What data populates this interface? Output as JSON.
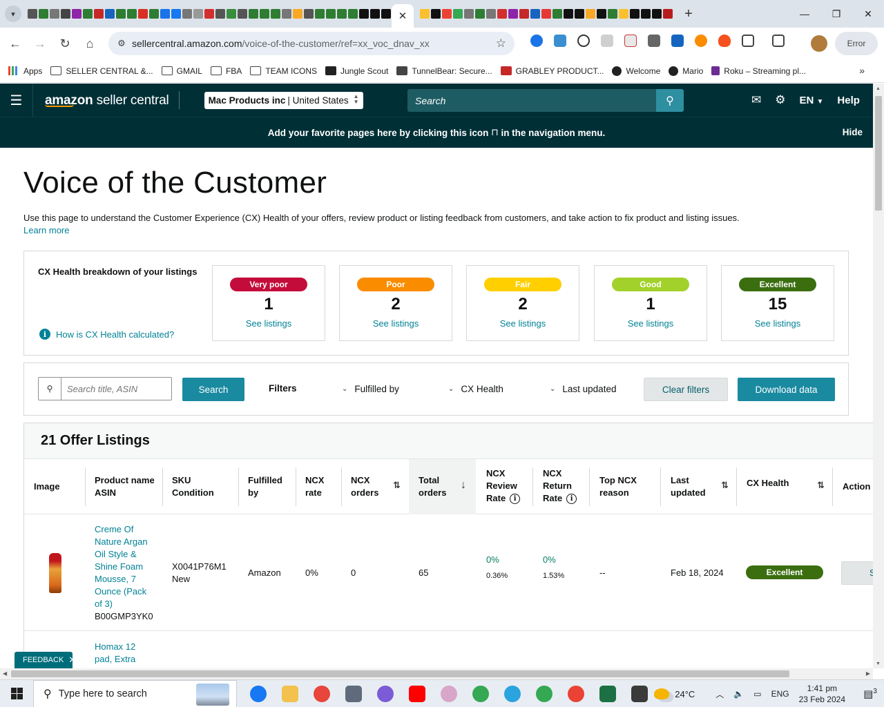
{
  "browser": {
    "url_host": "sellercentral.amazon.com",
    "url_path": "/voice-of-the-customer/ref=xx_voc_dnav_xx",
    "error_label": "Error",
    "bookmarks": [
      {
        "label": "Apps",
        "icon": "apps-grid-icon"
      },
      {
        "label": "SELLER CENTRAL &...",
        "icon": "folder-icon"
      },
      {
        "label": "GMAIL",
        "icon": "folder-icon"
      },
      {
        "label": "FBA",
        "icon": "folder-icon"
      },
      {
        "label": "TEAM ICONS",
        "icon": "folder-icon"
      },
      {
        "label": "Jungle Scout",
        "icon": "junglescout-icon"
      },
      {
        "label": "TunnelBear: Secure...",
        "icon": "tunnelbear-icon"
      },
      {
        "label": "GRABLEY PRODUCT...",
        "icon": "grabley-icon"
      },
      {
        "label": "Welcome",
        "icon": "globe-icon"
      },
      {
        "label": "Mario",
        "icon": "globe-icon"
      },
      {
        "label": "Roku – Streaming pl...",
        "icon": "roku-icon"
      }
    ]
  },
  "header": {
    "logo_text": "amazon",
    "logo_suffix": "seller central",
    "account_name": "Mac Products inc",
    "account_region": "United States",
    "search_placeholder": "Search",
    "language": "EN",
    "help": "Help"
  },
  "banner": {
    "text_before": "Add your favorite pages here by clicking this icon",
    "text_after": "in the navigation menu.",
    "hide": "Hide"
  },
  "page": {
    "title": "Voice of the Customer",
    "description": "Use this page to understand the Customer Experience (CX) Health of your offers, review product or listing feedback from customers, and take action to fix product and listing issues.",
    "learn_more": "Learn more"
  },
  "cx_health": {
    "label": "CX Health breakdown of your listings",
    "how_link": "How is CX Health calculated?",
    "cards": [
      {
        "rating": "Very poor",
        "count": "1",
        "link": "See listings",
        "color": "#c40c3a",
        "text_color": "#ffffff"
      },
      {
        "rating": "Poor",
        "count": "2",
        "link": "See listings",
        "color": "#fa8c00",
        "text_color": "#ffffff"
      },
      {
        "rating": "Fair",
        "count": "2",
        "link": "See listings",
        "color": "#ffcf00",
        "text_color": "#ffffff"
      },
      {
        "rating": "Good",
        "count": "1",
        "link": "See listings",
        "color": "#a3d12b",
        "text_color": "#ffffff"
      },
      {
        "rating": "Excellent",
        "count": "15",
        "link": "See listings",
        "color": "#3b6e0f",
        "text_color": "#ffffff"
      }
    ]
  },
  "filters": {
    "search_placeholder": "Search title, ASIN",
    "search_button": "Search",
    "label": "Filters",
    "fulfilled_by": "Fulfilled by",
    "cx_health": "CX Health",
    "last_updated": "Last updated",
    "clear": "Clear filters",
    "download": "Download data"
  },
  "listings": {
    "title": "21 Offer Listings",
    "columns": {
      "image": "Image",
      "product_name": "Product name",
      "asin": "ASIN",
      "sku": "SKU",
      "condition": "Condition",
      "fulfilled_1": "Fulfilled",
      "fulfilled_2": "by",
      "ncx_rate_1": "NCX",
      "ncx_rate_2": "rate",
      "ncx_orders_1": "NCX",
      "ncx_orders_2": "orders",
      "total_orders_1": "Total",
      "total_orders_2": "orders",
      "review_rate_1": "NCX",
      "review_rate_2": "Review",
      "review_rate_3": "Rate",
      "return_rate_1": "NCX",
      "return_rate_2": "Return",
      "return_rate_3": "Rate",
      "top_reason_1": "Top NCX",
      "top_reason_2": "reason",
      "last_updated_1": "Last",
      "last_updated_2": "updated",
      "cx_health": "CX Health",
      "action": "Action"
    },
    "rows": [
      {
        "name_lines": [
          "Creme Of",
          "Nature Argan",
          "Oil Style &",
          "Shine Foam",
          "Mousse, 7",
          "Ounce (Pack",
          "of 3)"
        ],
        "asin": "B00GMP3YK0",
        "sku": "X0041P76M1",
        "condition": "New",
        "fulfilled_by": "Amazon",
        "ncx_rate": "0%",
        "ncx_orders": "0",
        "total_orders": "65",
        "review_rate": "0%",
        "review_rate_sub": "0.36%",
        "return_rate": "0%",
        "return_rate_sub": "1.53%",
        "top_reason": "--",
        "last_updated": "Feb 18, 2024",
        "cx_health": "Excellent",
        "action": "S"
      },
      {
        "name_lines": [
          "Homax 12",
          "pad, Extra"
        ]
      }
    ]
  },
  "feedback": {
    "label": "FEEDBACK"
  },
  "taskbar": {
    "search_placeholder": "Type here to search",
    "weather": "24°C",
    "lang": "ENG",
    "time": "1:41 pm",
    "date": "23 Feb 2024",
    "notifications": "3"
  }
}
